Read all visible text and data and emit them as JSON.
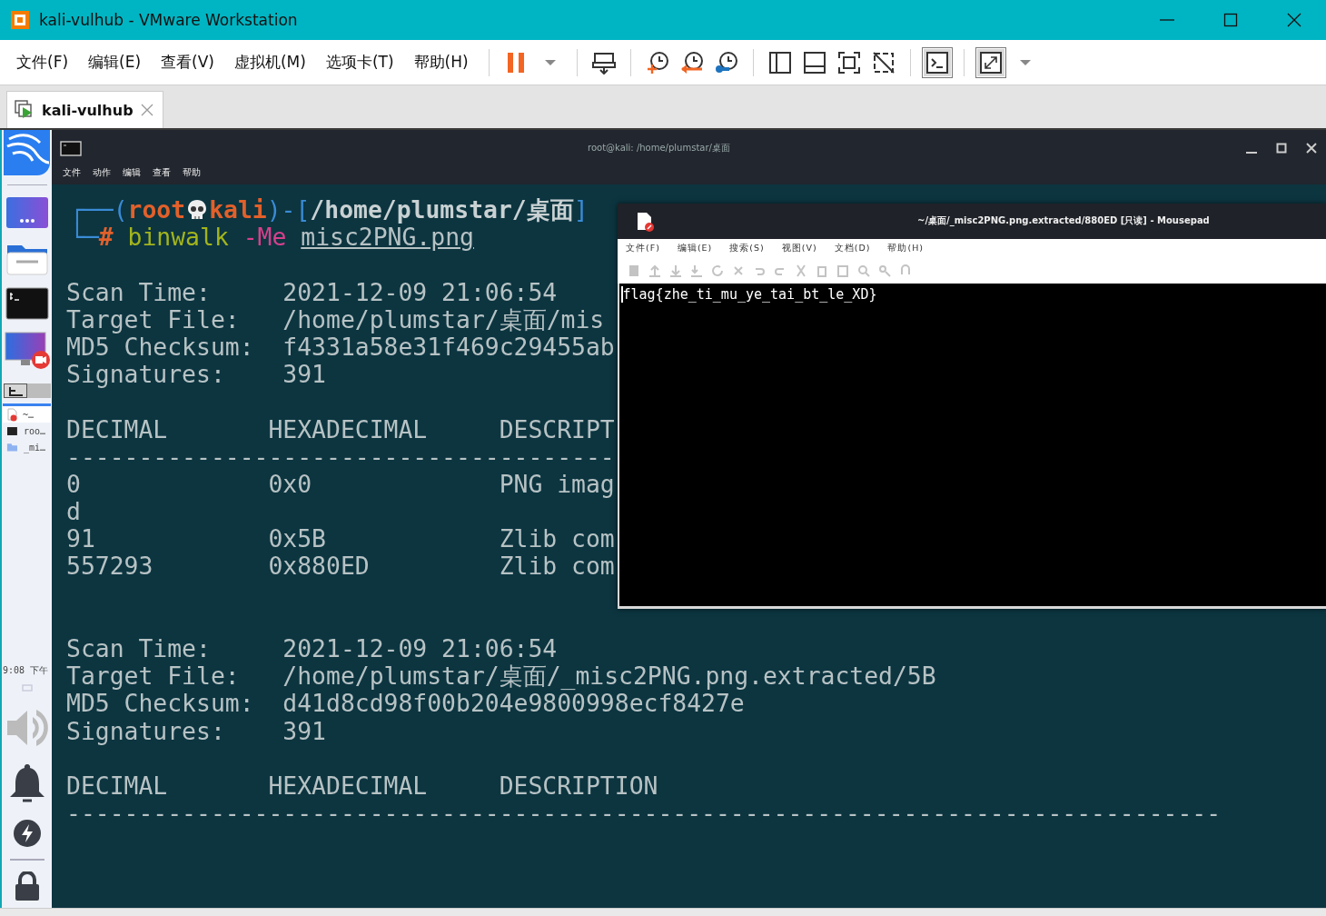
{
  "window": {
    "title": "kali-vulhub - VMware Workstation"
  },
  "menu": [
    "文件(F)",
    "编辑(E)",
    "查看(V)",
    "虚拟机(M)",
    "选项卡(T)",
    "帮助(H)"
  ],
  "toolbar": [
    {
      "kind": "pause",
      "pressed": false
    },
    {
      "kind": "caret",
      "pressed": false
    },
    {
      "kind": "sep"
    },
    {
      "kind": "sendkeys",
      "pressed": false
    },
    {
      "kind": "sep"
    },
    {
      "kind": "snapshot",
      "pressed": false
    },
    {
      "kind": "revert",
      "pressed": false
    },
    {
      "kind": "manage",
      "pressed": false
    },
    {
      "kind": "sep"
    },
    {
      "kind": "sidebar",
      "pressed": false
    },
    {
      "kind": "thumbs",
      "pressed": false
    },
    {
      "kind": "full",
      "pressed": false
    },
    {
      "kind": "unity",
      "pressed": false
    },
    {
      "kind": "sep"
    },
    {
      "kind": "console",
      "pressed": true
    },
    {
      "kind": "sep"
    },
    {
      "kind": "stretch",
      "pressed": true
    },
    {
      "kind": "caret",
      "pressed": false
    }
  ],
  "tabs": [
    {
      "label": "kali-vulhub",
      "selected": true
    }
  ],
  "kali_panel": {
    "launchers": [
      {
        "kind": "apps"
      },
      {
        "kind": "folder"
      },
      {
        "kind": "terminal"
      },
      {
        "kind": "recorder"
      }
    ],
    "tasks": [
      {
        "kind": "editor",
        "label": "~…",
        "selected": true
      },
      {
        "kind": "terminal",
        "label": "roo…",
        "selected": false
      },
      {
        "kind": "folder",
        "label": "_mi…",
        "selected": false
      }
    ],
    "clock": "9:08 下午"
  },
  "terminal": {
    "title": "root@kali: /home/plumstar/桌面",
    "menu": [
      "文件",
      "动作",
      "编辑",
      "查看",
      "帮助"
    ],
    "prompt": {
      "corner_top": "┌──",
      "open": "(",
      "user": "root",
      "host": "kali",
      "close": ")",
      "separator": "-[",
      "path": "/home/plumstar/桌面",
      "path_close": "]",
      "corner_bottom": "└─",
      "sign": "#",
      "command": "binwalk",
      "option": "-Me",
      "argument": "misc2PNG.png"
    },
    "lines": [
      {
        "kind": "blank"
      },
      {
        "kind": "text",
        "text": "Scan Time:     2021-12-09 21:06:54"
      },
      {
        "kind": "text",
        "text": "Target File:   /home/plumstar/桌面/mis"
      },
      {
        "kind": "text",
        "text": "MD5 Checksum:  f4331a58e31f469c29455ab"
      },
      {
        "kind": "text",
        "text": "Signatures:    391"
      },
      {
        "kind": "blank"
      },
      {
        "kind": "text",
        "text": "DECIMAL       HEXADECIMAL     DESCRIPT"
      },
      {
        "kind": "text",
        "text": "--------------------------------------"
      },
      {
        "kind": "text",
        "text": "0             0x0             PNG imag"
      },
      {
        "kind": "text",
        "text": "d"
      },
      {
        "kind": "text",
        "text": "91            0x5B            Zlib com"
      },
      {
        "kind": "text",
        "text": "557293        0x880ED         Zlib com"
      },
      {
        "kind": "blank"
      },
      {
        "kind": "blank"
      },
      {
        "kind": "text",
        "text": "Scan Time:     2021-12-09 21:06:54"
      },
      {
        "kind": "text",
        "text": "Target File:   /home/plumstar/桌面/_misc2PNG.png.extracted/5B"
      },
      {
        "kind": "text",
        "text": "MD5 Checksum:  d41d8cd98f00b204e9800998ecf8427e"
      },
      {
        "kind": "text",
        "text": "Signatures:    391"
      },
      {
        "kind": "blank"
      },
      {
        "kind": "text",
        "text": "DECIMAL       HEXADECIMAL     DESCRIPTION"
      },
      {
        "kind": "text",
        "text": "--------------------------------------------------------------------------------"
      }
    ]
  },
  "mousepad": {
    "title": "~/桌面/_misc2PNG.png.extracted/880ED [只读] - Mousepad",
    "menu": [
      "文件(F)",
      "编辑(E)",
      "搜索(S)",
      "视图(V)",
      "文档(D)",
      "帮助(H)"
    ],
    "text": "flag{zhe_ti_mu_ye_tai_bt_le_XD}"
  }
}
